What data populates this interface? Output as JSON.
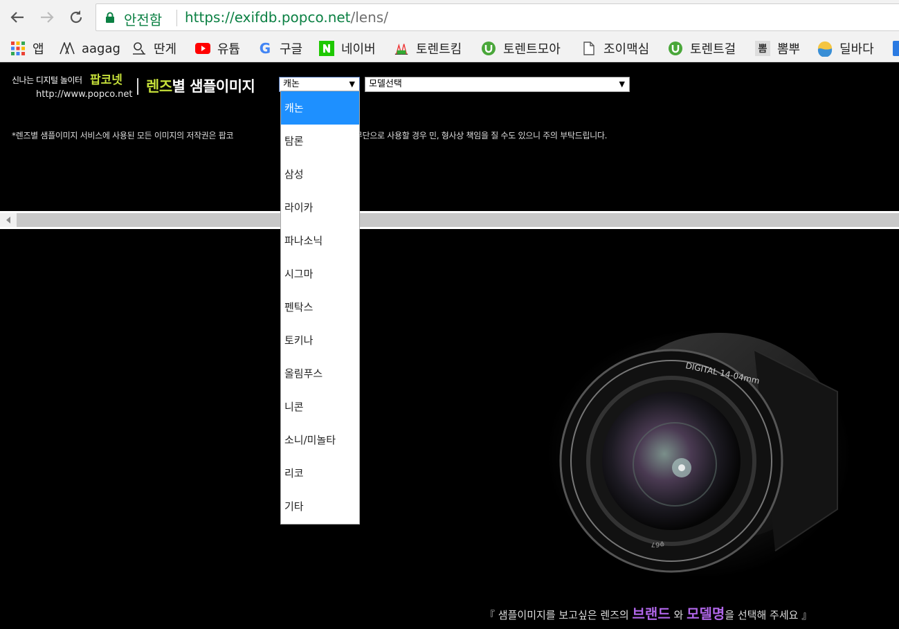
{
  "browser": {
    "secure_label": "안전함",
    "url_host": "https://exifdb.popco.net",
    "url_path": "/lens/"
  },
  "bookmarks": [
    {
      "label": "앱",
      "icon": "apps-grid-icon"
    },
    {
      "label": "aagag",
      "icon": "aagag-icon"
    },
    {
      "label": "딴게",
      "icon": "ddanzi-icon"
    },
    {
      "label": "유튭",
      "icon": "youtube-icon"
    },
    {
      "label": "구글",
      "icon": "google-icon"
    },
    {
      "label": "네이버",
      "icon": "naver-icon"
    },
    {
      "label": "토렌트킴",
      "icon": "torrentkim-icon"
    },
    {
      "label": "토렌트모아",
      "icon": "utorrent-icon"
    },
    {
      "label": "조이맥심",
      "icon": "page-icon"
    },
    {
      "label": "토렌트걸",
      "icon": "utorrent-icon"
    },
    {
      "label": "뽐뿌",
      "icon": "ppomppu-icon"
    },
    {
      "label": "딜바다",
      "icon": "dealbada-icon"
    }
  ],
  "header": {
    "logo_tagline": "신나는 디지털 놀이터",
    "logo_brand": "팝코넷",
    "logo_url": "http://www.popco.net",
    "title_highlight": "렌즈",
    "title_rest": "별 샘플이미지"
  },
  "selects": {
    "brand_value": "캐논",
    "model_value": "모델선택"
  },
  "notice": {
    "left": "*렌즈별 샘플이미지 서비스에 사용된 모든 이미지의 저작권은 팝코",
    "right": "무런 협의없이 무단으로 사용할 경우 민, 형사상 책임을 질 수도 있으니 주의 부탁드립니다."
  },
  "caption": {
    "open": "『",
    "part1": "샘플이미지를 보고싶은 렌즈의",
    "brand": "브랜드",
    "part2": "와",
    "model": "모델명",
    "part3": "을 선택해 주세요",
    "close": "』"
  },
  "dropdown": {
    "options": [
      "캐논",
      "탐론",
      "삼성",
      "라이카",
      "파나소닉",
      "시그마",
      "펜탁스",
      "토키나",
      "올림푸스",
      "니콘",
      "소니/미놀타",
      "리코",
      "기타"
    ],
    "selected_index": 0
  },
  "colors": {
    "accent_green": "#c6e03a",
    "selected_blue": "#1e90ff",
    "caption_purple": "#b066e8",
    "secure_green": "#0b8043"
  }
}
